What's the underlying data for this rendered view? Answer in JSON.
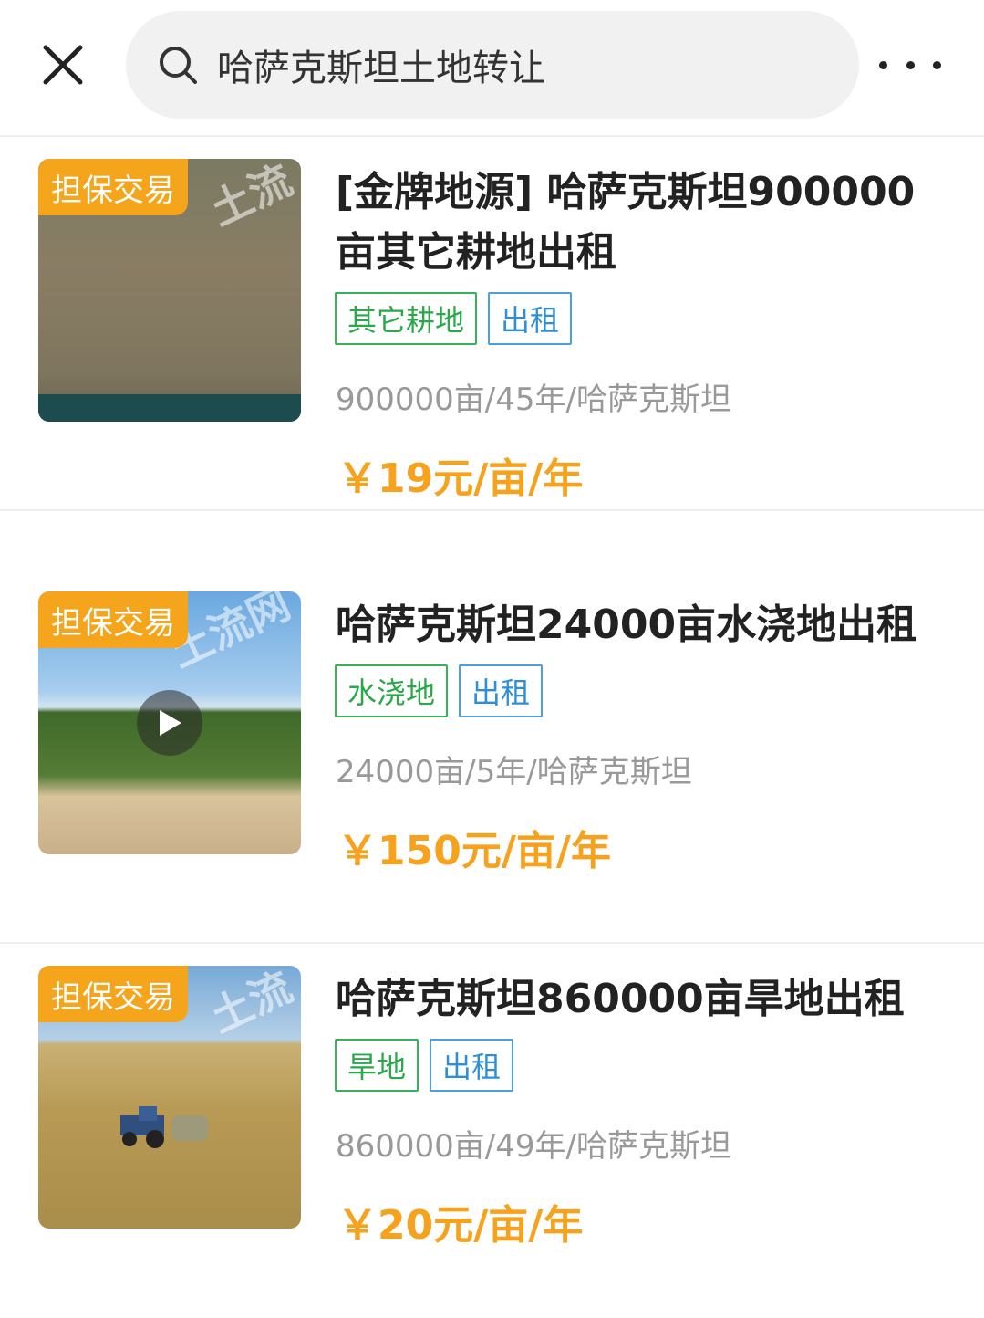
{
  "header": {
    "search_value": "哈萨克斯坦土地转让",
    "close_icon": "close-icon",
    "search_icon": "search-icon",
    "more_icon": "more-icon"
  },
  "listings": [
    {
      "badge": "担保交易",
      "title": "[金牌地源] 哈萨克斯坦900000亩其它耕地出租",
      "tags": [
        {
          "label": "其它耕地",
          "color": "green"
        },
        {
          "label": "出租",
          "color": "blue"
        }
      ],
      "meta": "900000亩/45年/哈萨克斯坦",
      "price": "￥19元/亩/年",
      "has_video": false
    },
    {
      "badge": "担保交易",
      "title": "哈萨克斯坦24000亩水浇地出租",
      "tags": [
        {
          "label": "水浇地",
          "color": "green"
        },
        {
          "label": "出租",
          "color": "blue"
        }
      ],
      "meta": "24000亩/5年/哈萨克斯坦",
      "price": "￥150元/亩/年",
      "has_video": true
    },
    {
      "badge": "担保交易",
      "title": "哈萨克斯坦860000亩旱地出租",
      "tags": [
        {
          "label": "旱地",
          "color": "green"
        },
        {
          "label": "出租",
          "color": "blue"
        }
      ],
      "meta": "860000亩/49年/哈萨克斯坦",
      "price": "￥20元/亩/年",
      "has_video": false
    }
  ],
  "colors": {
    "accent_orange": "#f7a21d",
    "tag_green": "#2aa84a",
    "tag_blue": "#2d8fd8"
  }
}
